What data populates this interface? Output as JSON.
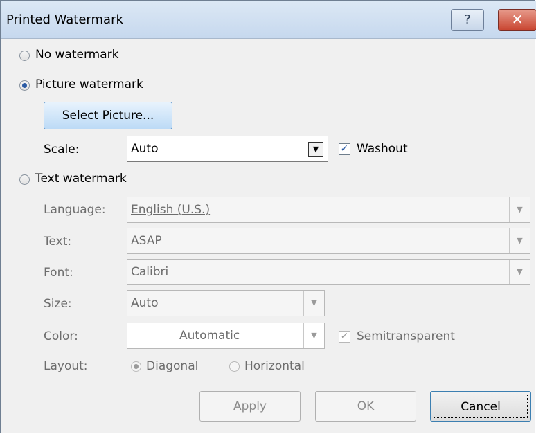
{
  "window": {
    "title": "Printed Watermark",
    "help_glyph": "?",
    "close_glyph": "✕"
  },
  "options": {
    "no_watermark": "No watermark",
    "picture_watermark": "Picture watermark",
    "text_watermark": "Text watermark"
  },
  "picture": {
    "select_button": "Select Picture...",
    "scale_label": "Scale:",
    "scale_value": "Auto",
    "washout_label": "Washout",
    "washout_checked": true
  },
  "text": {
    "language_label": "Language:",
    "language_value": "English (U.S.)",
    "text_label": "Text:",
    "text_value": "ASAP",
    "font_label": "Font:",
    "font_value": "Calibri",
    "size_label": "Size:",
    "size_value": "Auto",
    "color_label": "Color:",
    "color_value": "Automatic",
    "semitransparent_label": "Semitransparent",
    "semitransparent_checked": true,
    "layout_label": "Layout:",
    "layout_diagonal": "Diagonal",
    "layout_horizontal": "Horizontal"
  },
  "buttons": {
    "apply": "Apply",
    "ok": "OK",
    "cancel": "Cancel"
  },
  "icons": {
    "dropdown": "chevron-down-icon",
    "check": "check-icon"
  }
}
